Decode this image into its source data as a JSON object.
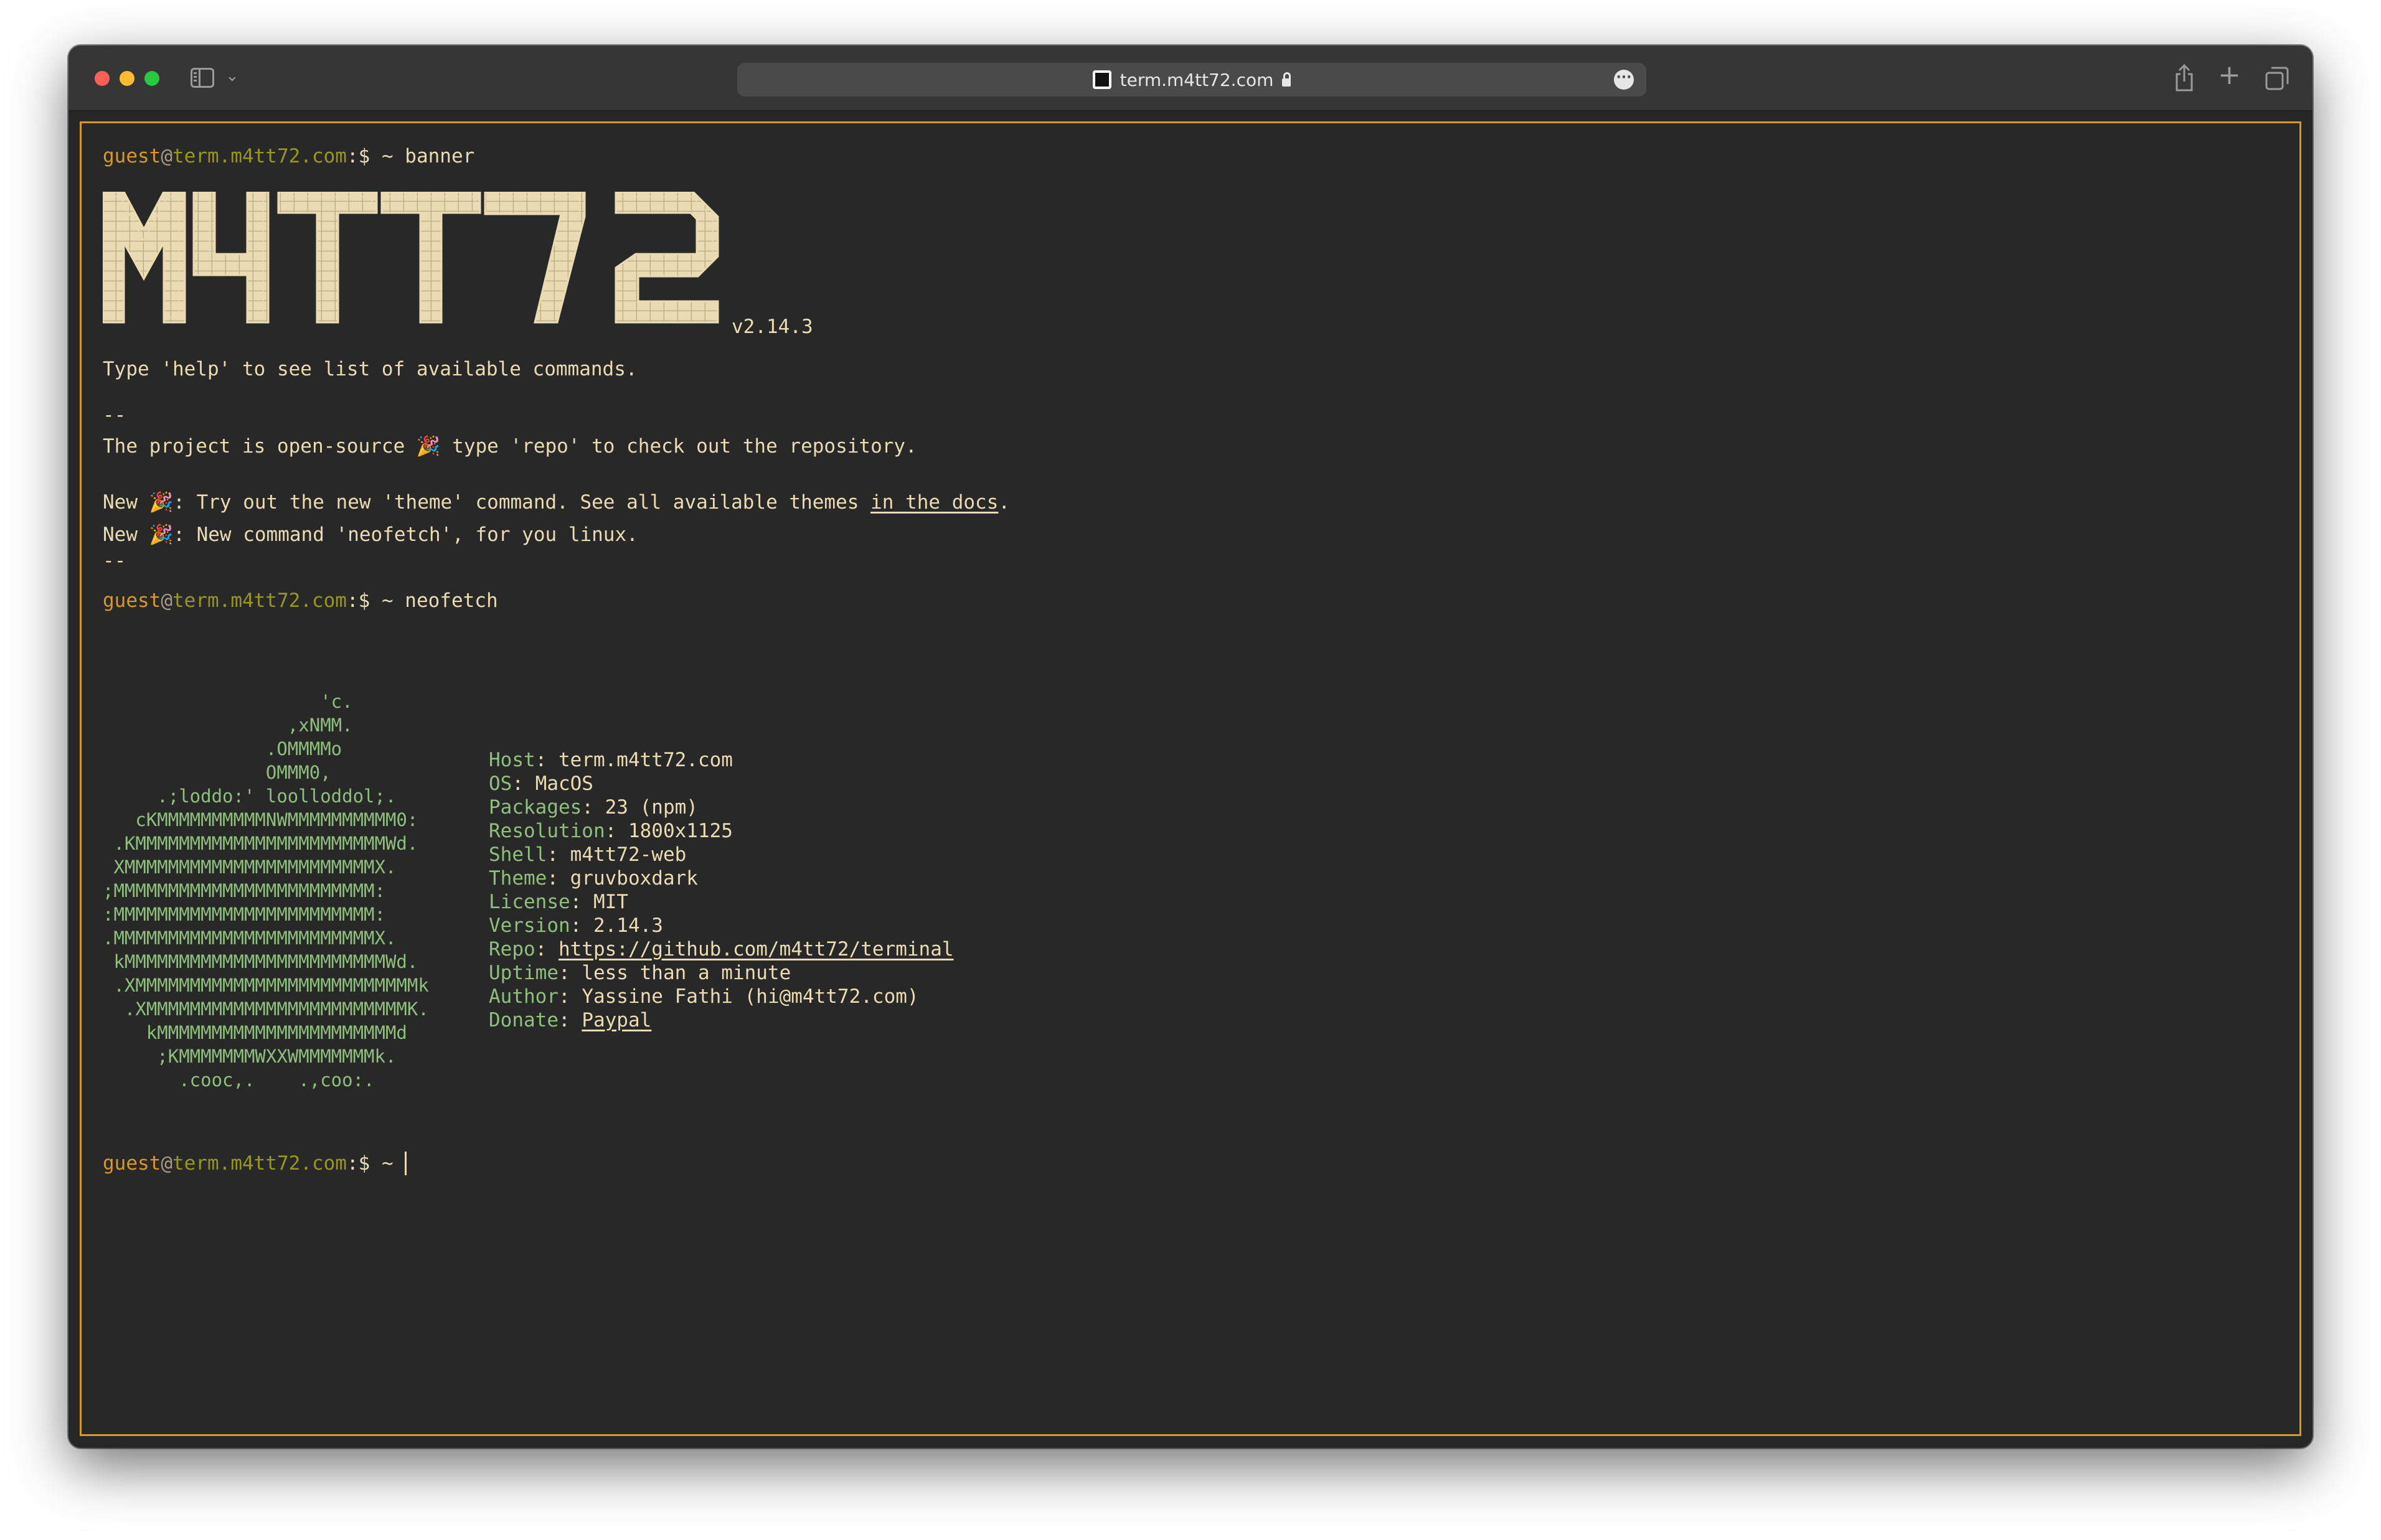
{
  "browser": {
    "url": "term.m4tt72.com"
  },
  "prompt": {
    "user": "guest",
    "at": "@",
    "host": "term.m4tt72.com",
    "suffix": ":$ ~ "
  },
  "session": {
    "command_1": "banner",
    "banner_logo": "M4TT72",
    "version": "v2.14.3",
    "help_line": "Type 'help' to see list of available commands.",
    "separator": "--",
    "open_source_before": "The project is open-source 🎉 type 'repo' to check out the repository.",
    "new1_before": "New 🎉: Try out the new 'theme' command. See all available themes ",
    "new1_link": "in the docs",
    "new1_after": ".",
    "new2": "New 🎉: New command 'neofetch', for you linux.",
    "command_2": "neofetch"
  },
  "neofetch": {
    "art": "                    'c.\n                 ,xNMM.\n               .OMMMMo\n               OMMM0,\n     .;loddo:' loolloddol;.\n   cKMMMMMMMMMMNWMMMMMMMMMM0:\n .KMMMMMMMMMMMMMMMMMMMMMMMWd.\n XMMMMMMMMMMMMMMMMMMMMMMMX.\n;MMMMMMMMMMMMMMMMMMMMMMMM:\n:MMMMMMMMMMMMMMMMMMMMMMMM:\n.MMMMMMMMMMMMMMMMMMMMMMMMX.\n kMMMMMMMMMMMMMMMMMMMMMMMMWd.\n .XMMMMMMMMMMMMMMMMMMMMMMMMMMk\n  .XMMMMMMMMMMMMMMMMMMMMMMMMK.\n    kMMMMMMMMMMMMMMMMMMMMMMd\n     ;KMMMMMMMWXXWMMMMMMMk.\n       .cooc,.    .,coo:.",
    "info": [
      {
        "key": "Host",
        "value": "term.m4tt72.com"
      },
      {
        "key": "OS",
        "value": "MacOS"
      },
      {
        "key": "Packages",
        "value": "23 (npm)"
      },
      {
        "key": "Resolution",
        "value": "1800x1125"
      },
      {
        "key": "Shell",
        "value": "m4tt72-web"
      },
      {
        "key": "Theme",
        "value": "gruvboxdark"
      },
      {
        "key": "License",
        "value": "MIT"
      },
      {
        "key": "Version",
        "value": "2.14.3"
      },
      {
        "key": "Repo",
        "value": "https://github.com/m4tt72/terminal"
      },
      {
        "key": "Uptime",
        "value": "less than a minute"
      },
      {
        "key": "Author",
        "value": "Yassine Fathi (hi@m4tt72.com)"
      },
      {
        "key": "Donate",
        "value": "Paypal"
      }
    ]
  },
  "colors": {
    "background": "#282828",
    "foreground": "#ebdbb2",
    "border": "#d79921",
    "user": "#d79921",
    "host": "#98971a",
    "art": "#8ec07c"
  }
}
